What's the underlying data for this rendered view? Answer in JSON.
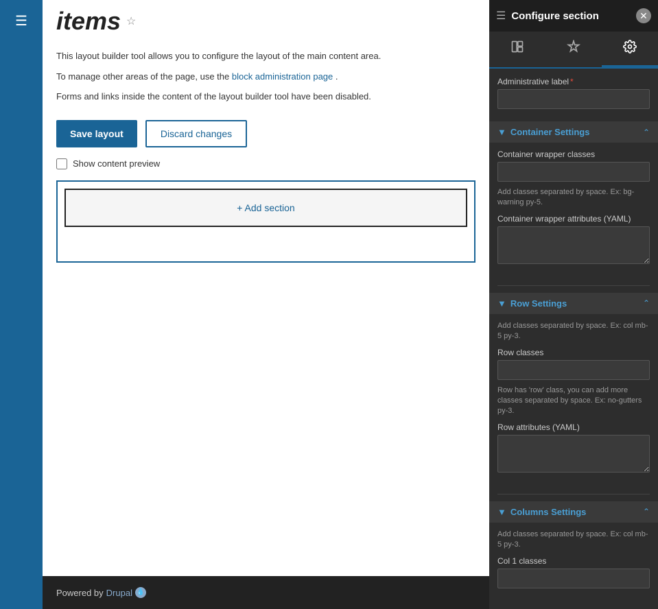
{
  "leftNav": {
    "hamburger": "☰"
  },
  "pageHeader": {
    "title": "items",
    "starIcon": "☆"
  },
  "pageBody": {
    "infoLine1": "This layout builder tool allows you to configure the layout of the main content area.",
    "infoLine2_prefix": "To manage other areas of the page, use the ",
    "infoLine2_link": "block administration page",
    "infoLine2_suffix": ".",
    "infoLine3": "Forms and links inside the content of the layout builder tool have been disabled.",
    "saveButton": "Save layout",
    "discardButton": "Discard changes",
    "showContentPreviewLabel": "Show content preview",
    "addSectionLabel": "+ Add section"
  },
  "footer": {
    "poweredBy": "Powered by ",
    "drupalLink": "Drupal",
    "iconSymbol": "💧"
  },
  "rightPanel": {
    "title": "Configure section",
    "tabs": [
      {
        "icon": "layout",
        "label": "Layout"
      },
      {
        "icon": "paint",
        "label": "Style"
      },
      {
        "icon": "gear",
        "label": "Settings",
        "active": true
      }
    ],
    "administrativeLabelText": "Administrative label",
    "requiredStar": "*",
    "containerSettings": {
      "title": "Container Settings",
      "wrapperClassesLabel": "Container wrapper classes",
      "wrapperClassesHint": "Add classes separated by space. Ex: bg-warning py-5.",
      "wrapperAttributesLabel": "Container wrapper attributes (YAML)"
    },
    "rowSettings": {
      "title": "Row Settings",
      "hint": "Add classes separated by space. Ex: col mb-5 py-3.",
      "rowClassesLabel": "Row classes",
      "rowClassesHint": "Row has 'row' class, you can add more classes separated by space. Ex: no-gutters py-3.",
      "rowAttributesLabel": "Row attributes (YAML)"
    },
    "columnsSettings": {
      "title": "Columns Settings",
      "hint": "Add classes separated by space. Ex: col mb-5 py-3.",
      "col1ClassesLabel": "Col 1 classes"
    }
  }
}
